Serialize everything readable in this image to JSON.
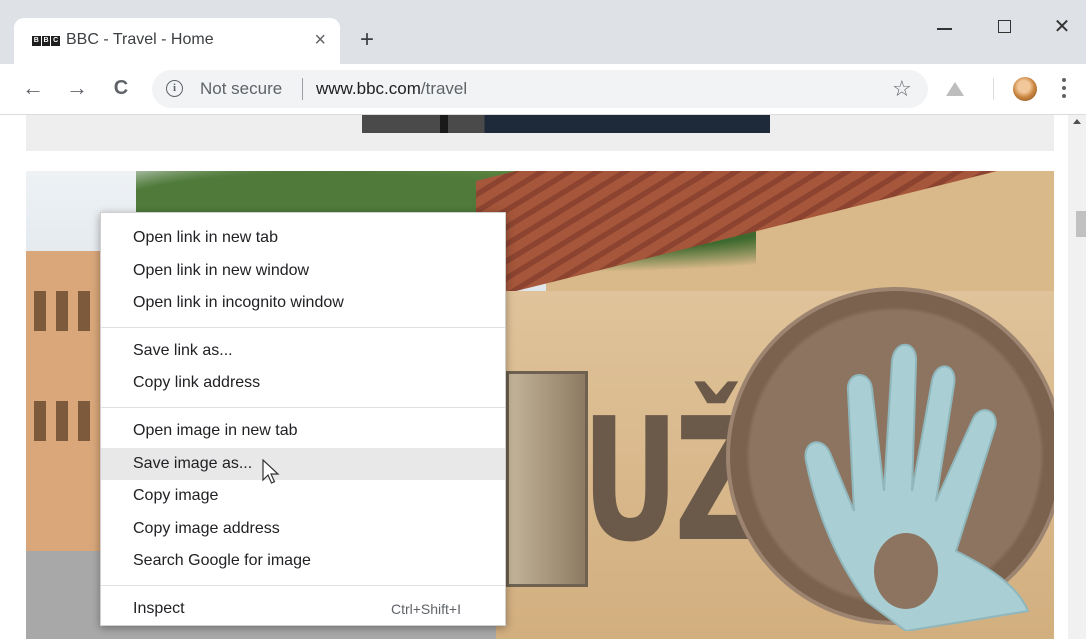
{
  "browser": {
    "tab": {
      "favicon_text": [
        "B",
        "B",
        "C"
      ],
      "title": "BBC - Travel - Home",
      "close_glyph": "×"
    },
    "new_tab_glyph": "+",
    "window_controls": {
      "close_glyph": "✕"
    },
    "toolbar": {
      "back_glyph": "←",
      "forward_glyph": "→",
      "reload_glyph": "C",
      "info_glyph": "i",
      "security_label": "Not secure",
      "url_host": "www.bbc.com",
      "url_path": "/travel",
      "star_glyph": "☆"
    }
  },
  "page": {
    "hero_letters": "UŽ"
  },
  "context_menu": {
    "groups": [
      [
        "Open link in new tab",
        "Open link in new window",
        "Open link in incognito window"
      ],
      [
        "Save link as...",
        "Copy link address"
      ],
      [
        "Open image in new tab",
        "Save image as...",
        "Copy image",
        "Copy image address",
        "Search Google for image"
      ],
      [
        "Inspect"
      ]
    ],
    "hovered_item": "Save image as...",
    "inspect_shortcut": "Ctrl+Shift+I"
  },
  "colors": {
    "tabstrip": "#dee1e6",
    "omnibox": "#f1f3f4",
    "menu_hover": "#e8e8e8"
  },
  "icons": [
    "bbc-favicon",
    "tab-close-icon",
    "new-tab-icon",
    "minimize-icon",
    "maximize-icon",
    "close-window-icon",
    "back-icon",
    "forward-icon",
    "reload-icon",
    "info-icon",
    "bookmark-star-icon",
    "extension-icon",
    "profile-avatar",
    "more-menu-icon",
    "mouse-pointer-icon"
  ]
}
